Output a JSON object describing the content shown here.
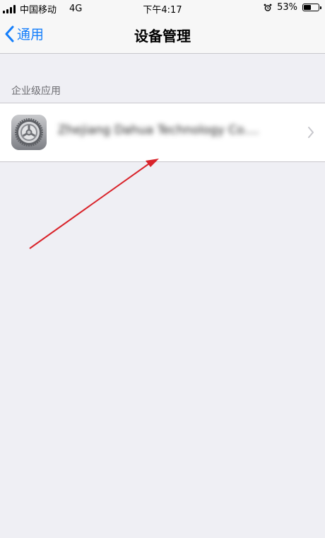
{
  "status_bar": {
    "carrier": "中国移动",
    "network": "4G",
    "time": "下午4:17",
    "battery_percent_label": "53%",
    "battery_level": 0.53,
    "alarm_icon": "alarm-clock-icon",
    "signal_icon": "cellular-signal-icon"
  },
  "nav": {
    "back_label": "通用",
    "back_icon": "chevron-left-icon",
    "title": "设备管理",
    "accent_color": "#147efb"
  },
  "section": {
    "header": "企业级应用"
  },
  "profile_row": {
    "label": "Zhejiang Dahua Technology Co....",
    "icon": "settings-gear-icon",
    "disclosure_icon": "chevron-right-icon"
  },
  "annotation": {
    "arrow_color": "#d9232a"
  }
}
